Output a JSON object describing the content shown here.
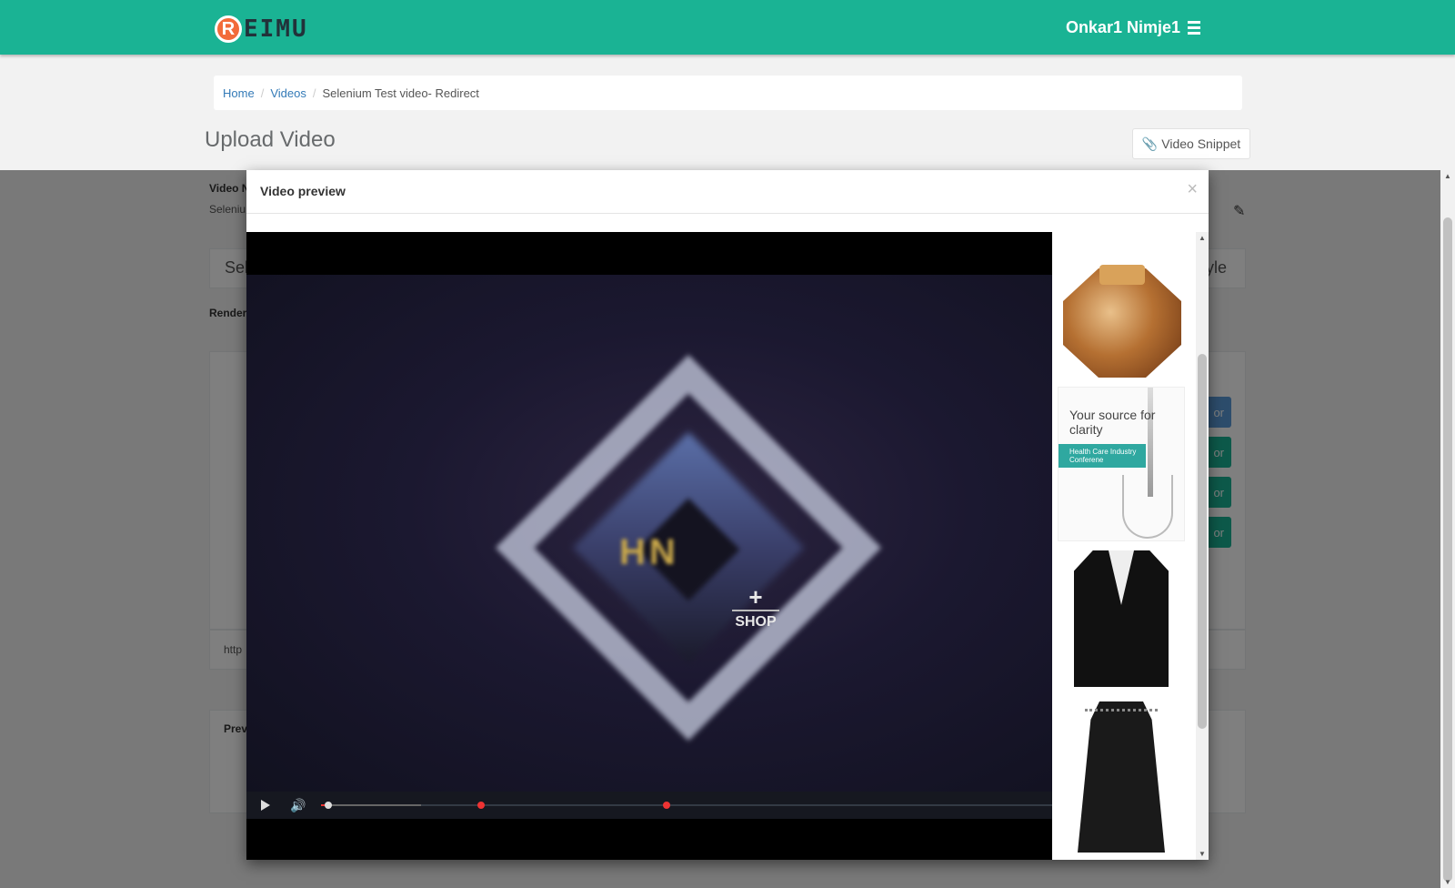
{
  "header": {
    "logo_initial": "R",
    "logo_text": "EIMU",
    "user_name": "Onkar1 Nimje1",
    "accent_color": "#1ab394"
  },
  "breadcrumb": {
    "items": [
      "Home",
      "Videos"
    ],
    "current": "Selenium Test video- Redirect"
  },
  "page": {
    "title": "Upload Video",
    "snippet_button": "Video Snippet"
  },
  "background": {
    "video_name_label": "Video N",
    "video_name_value": "Seleniu",
    "select_text": "Sel",
    "style_text": "yle",
    "render_label": "Render",
    "url_prefix": "http",
    "preview_label": "Prev",
    "btn_label": "or"
  },
  "modal": {
    "title": "Video preview",
    "close": "×",
    "shop": {
      "plus": "+",
      "label": "SHOP"
    },
    "products": {
      "ad_headline": "Your source for clarity",
      "ad_sub": "Health Care Industry Conferene"
    }
  }
}
